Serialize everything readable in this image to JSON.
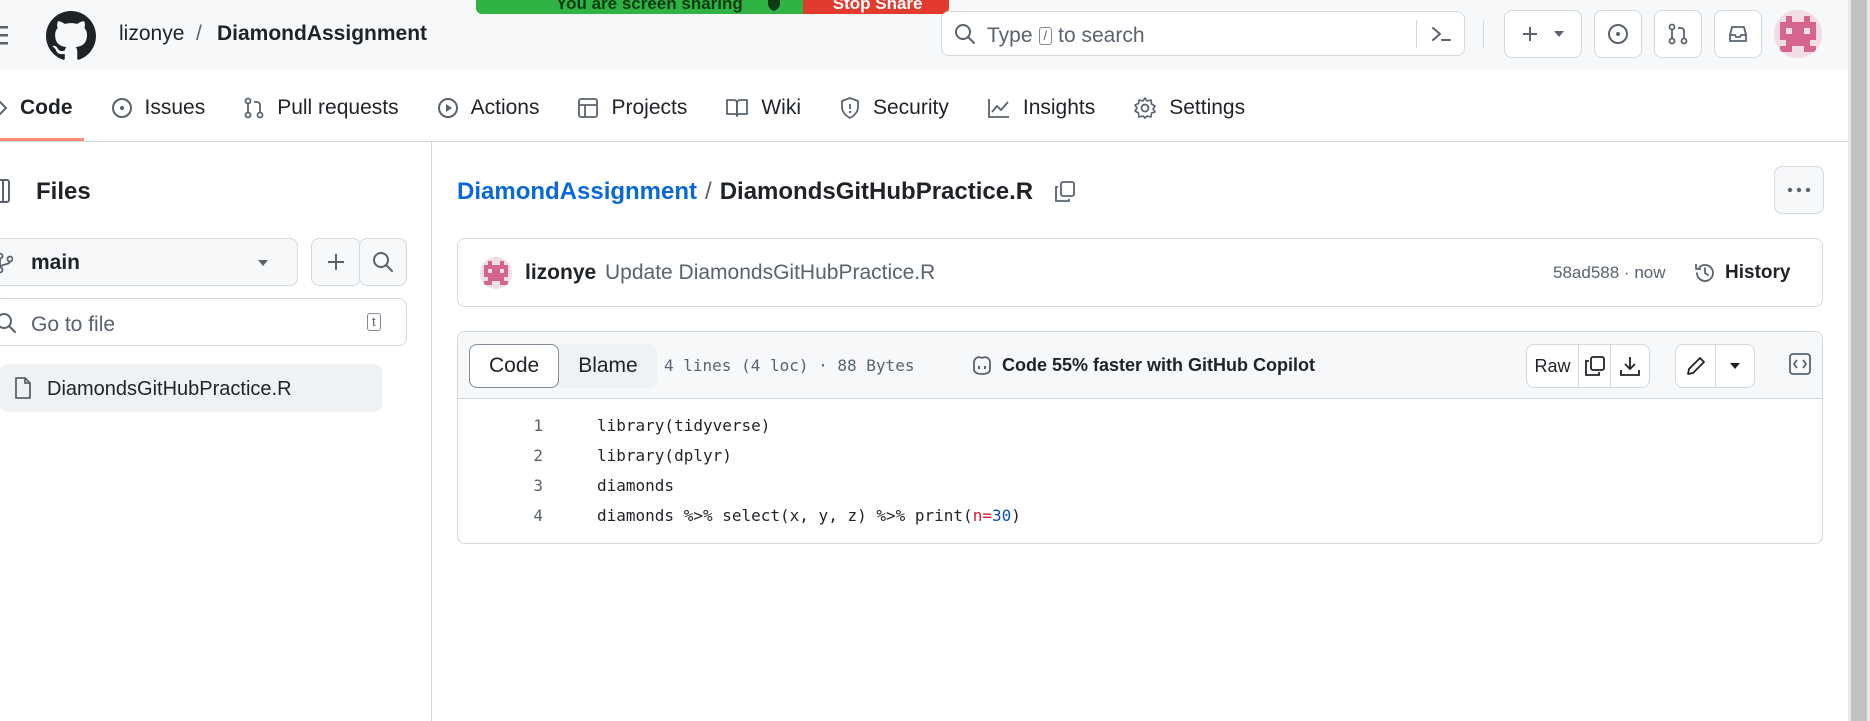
{
  "share_banner": {
    "sharing_text": "You are screen sharing",
    "stop_label": "Stop Share"
  },
  "header": {
    "owner": "lizonye",
    "separator": "/",
    "repo": "DiamondAssignment",
    "search": {
      "prefix": "Type",
      "key": "/",
      "suffix": "to search"
    }
  },
  "nav": {
    "items": [
      {
        "label": "Code",
        "icon": "code-icon",
        "selected": true
      },
      {
        "label": "Issues",
        "icon": "issue-opened-icon"
      },
      {
        "label": "Pull requests",
        "icon": "git-pull-request-icon"
      },
      {
        "label": "Actions",
        "icon": "play-icon"
      },
      {
        "label": "Projects",
        "icon": "table-icon"
      },
      {
        "label": "Wiki",
        "icon": "book-icon"
      },
      {
        "label": "Security",
        "icon": "shield-icon"
      },
      {
        "label": "Insights",
        "icon": "graph-icon"
      },
      {
        "label": "Settings",
        "icon": "gear-icon"
      }
    ]
  },
  "sidebar": {
    "title": "Files",
    "branch": "main",
    "goto_placeholder": "Go to file",
    "goto_key": "t",
    "files": [
      {
        "name": "DiamondsGitHubPractice.R",
        "icon": "file-icon"
      }
    ]
  },
  "breadcrumb": {
    "repo": "DiamondAssignment",
    "separator": "/",
    "file": "DiamondsGitHubPractice.R"
  },
  "commit": {
    "author": "lizonye",
    "message": "Update DiamondsGitHubPractice.R",
    "sha": "58ad588",
    "dot": "·",
    "time": "now",
    "history_label": "History"
  },
  "file": {
    "tabs": {
      "code": "Code",
      "blame": "Blame"
    },
    "info": "4 lines (4 loc) · 88 Bytes",
    "copilot": "Code 55% faster with GitHub Copilot",
    "raw_label": "Raw",
    "lines": [
      {
        "n": "1",
        "text": "library(tidyverse)"
      },
      {
        "n": "2",
        "text": "library(dplyr)"
      },
      {
        "n": "3",
        "text": "diamonds"
      },
      {
        "n": "4",
        "pre": "diamonds %>% select(x, y, z) %>% print(",
        "arg": "n",
        "eq": "=",
        "val": "30",
        "post": ")"
      }
    ]
  },
  "colors": {
    "accent_link": "#0969da",
    "nav_underline": "#fd8c73",
    "share_green": "#2fb344",
    "share_red": "#e23b2e"
  }
}
